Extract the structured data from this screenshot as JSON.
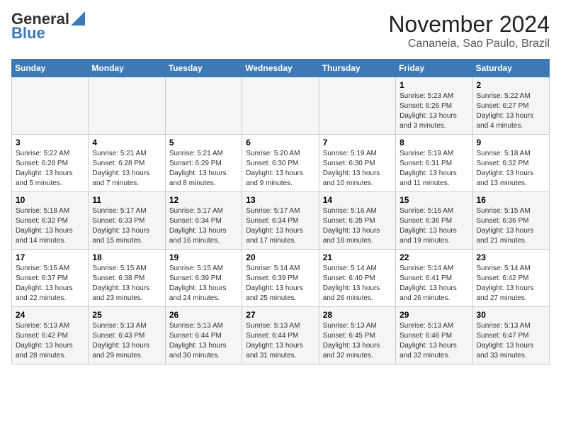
{
  "header": {
    "logo_line1": "General",
    "logo_line2": "Blue",
    "title": "November 2024",
    "subtitle": "Cananeia, Sao Paulo, Brazil"
  },
  "weekdays": [
    "Sunday",
    "Monday",
    "Tuesday",
    "Wednesday",
    "Thursday",
    "Friday",
    "Saturday"
  ],
  "weeks": [
    [
      {
        "day": "",
        "info": ""
      },
      {
        "day": "",
        "info": ""
      },
      {
        "day": "",
        "info": ""
      },
      {
        "day": "",
        "info": ""
      },
      {
        "day": "",
        "info": ""
      },
      {
        "day": "1",
        "info": "Sunrise: 5:23 AM\nSunset: 6:26 PM\nDaylight: 13 hours and 3 minutes."
      },
      {
        "day": "2",
        "info": "Sunrise: 5:22 AM\nSunset: 6:27 PM\nDaylight: 13 hours and 4 minutes."
      }
    ],
    [
      {
        "day": "3",
        "info": "Sunrise: 5:22 AM\nSunset: 6:28 PM\nDaylight: 13 hours and 5 minutes."
      },
      {
        "day": "4",
        "info": "Sunrise: 5:21 AM\nSunset: 6:28 PM\nDaylight: 13 hours and 7 minutes."
      },
      {
        "day": "5",
        "info": "Sunrise: 5:21 AM\nSunset: 6:29 PM\nDaylight: 13 hours and 8 minutes."
      },
      {
        "day": "6",
        "info": "Sunrise: 5:20 AM\nSunset: 6:30 PM\nDaylight: 13 hours and 9 minutes."
      },
      {
        "day": "7",
        "info": "Sunrise: 5:19 AM\nSunset: 6:30 PM\nDaylight: 13 hours and 10 minutes."
      },
      {
        "day": "8",
        "info": "Sunrise: 5:19 AM\nSunset: 6:31 PM\nDaylight: 13 hours and 11 minutes."
      },
      {
        "day": "9",
        "info": "Sunrise: 5:18 AM\nSunset: 6:32 PM\nDaylight: 13 hours and 13 minutes."
      }
    ],
    [
      {
        "day": "10",
        "info": "Sunrise: 5:18 AM\nSunset: 6:32 PM\nDaylight: 13 hours and 14 minutes."
      },
      {
        "day": "11",
        "info": "Sunrise: 5:17 AM\nSunset: 6:33 PM\nDaylight: 13 hours and 15 minutes."
      },
      {
        "day": "12",
        "info": "Sunrise: 5:17 AM\nSunset: 6:34 PM\nDaylight: 13 hours and 16 minutes."
      },
      {
        "day": "13",
        "info": "Sunrise: 5:17 AM\nSunset: 6:34 PM\nDaylight: 13 hours and 17 minutes."
      },
      {
        "day": "14",
        "info": "Sunrise: 5:16 AM\nSunset: 6:35 PM\nDaylight: 13 hours and 18 minutes."
      },
      {
        "day": "15",
        "info": "Sunrise: 5:16 AM\nSunset: 6:36 PM\nDaylight: 13 hours and 19 minutes."
      },
      {
        "day": "16",
        "info": "Sunrise: 5:15 AM\nSunset: 6:36 PM\nDaylight: 13 hours and 21 minutes."
      }
    ],
    [
      {
        "day": "17",
        "info": "Sunrise: 5:15 AM\nSunset: 6:37 PM\nDaylight: 13 hours and 22 minutes."
      },
      {
        "day": "18",
        "info": "Sunrise: 5:15 AM\nSunset: 6:38 PM\nDaylight: 13 hours and 23 minutes."
      },
      {
        "day": "19",
        "info": "Sunrise: 5:15 AM\nSunset: 6:39 PM\nDaylight: 13 hours and 24 minutes."
      },
      {
        "day": "20",
        "info": "Sunrise: 5:14 AM\nSunset: 6:39 PM\nDaylight: 13 hours and 25 minutes."
      },
      {
        "day": "21",
        "info": "Sunrise: 5:14 AM\nSunset: 6:40 PM\nDaylight: 13 hours and 26 minutes."
      },
      {
        "day": "22",
        "info": "Sunrise: 5:14 AM\nSunset: 6:41 PM\nDaylight: 13 hours and 26 minutes."
      },
      {
        "day": "23",
        "info": "Sunrise: 5:14 AM\nSunset: 6:42 PM\nDaylight: 13 hours and 27 minutes."
      }
    ],
    [
      {
        "day": "24",
        "info": "Sunrise: 5:13 AM\nSunset: 6:42 PM\nDaylight: 13 hours and 28 minutes."
      },
      {
        "day": "25",
        "info": "Sunrise: 5:13 AM\nSunset: 6:43 PM\nDaylight: 13 hours and 29 minutes."
      },
      {
        "day": "26",
        "info": "Sunrise: 5:13 AM\nSunset: 6:44 PM\nDaylight: 13 hours and 30 minutes."
      },
      {
        "day": "27",
        "info": "Sunrise: 5:13 AM\nSunset: 6:44 PM\nDaylight: 13 hours and 31 minutes."
      },
      {
        "day": "28",
        "info": "Sunrise: 5:13 AM\nSunset: 6:45 PM\nDaylight: 13 hours and 32 minutes."
      },
      {
        "day": "29",
        "info": "Sunrise: 5:13 AM\nSunset: 6:46 PM\nDaylight: 13 hours and 32 minutes."
      },
      {
        "day": "30",
        "info": "Sunrise: 5:13 AM\nSunset: 6:47 PM\nDaylight: 13 hours and 33 minutes."
      }
    ]
  ]
}
